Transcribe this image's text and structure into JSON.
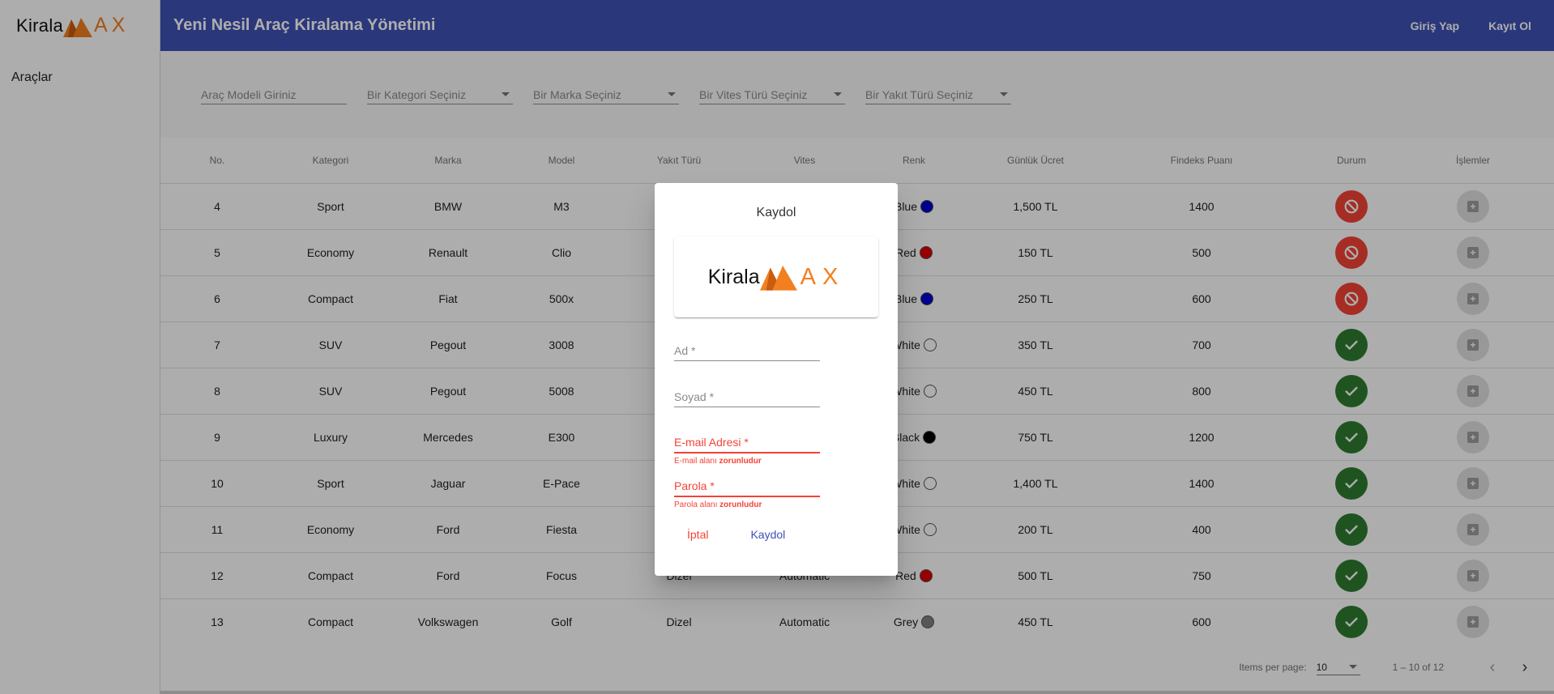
{
  "brand": {
    "name": "Kirala",
    "ax": "AX"
  },
  "sidebar": {
    "items": [
      {
        "label": "Araçlar"
      }
    ]
  },
  "toolbar": {
    "title": "Yeni Nesil Araç Kiralama Yönetimi",
    "login": "Giriş Yap",
    "register": "Kayıt Ol"
  },
  "filters": {
    "model_placeholder": "Araç Modeli Giriniz",
    "category_placeholder": "Bir Kategori Seçiniz",
    "brand_placeholder": "Bir Marka Seçiniz",
    "gear_placeholder": "Bir Vites Türü Seçiniz",
    "fuel_placeholder": "Bir Yakıt Türü Seçiniz"
  },
  "table": {
    "headers": [
      "No.",
      "Kategori",
      "Marka",
      "Model",
      "Yakıt Türü",
      "Vites",
      "Renk",
      "Günlük Ücret",
      "Findeks Puanı",
      "Durum",
      "İşlemler"
    ],
    "rows": [
      {
        "no": "4",
        "category": "Sport",
        "brand": "BMW",
        "model": "M3",
        "fuel": "",
        "gear": "",
        "color": "Blue",
        "color_hex": "#0000d0",
        "price": "1,500 TL",
        "findeks": "1400",
        "status": "unavailable"
      },
      {
        "no": "5",
        "category": "Economy",
        "brand": "Renault",
        "model": "Clio",
        "fuel": "",
        "gear": "",
        "color": "Red",
        "color_hex": "#e00000",
        "price": "150 TL",
        "findeks": "500",
        "status": "unavailable"
      },
      {
        "no": "6",
        "category": "Compact",
        "brand": "Fiat",
        "model": "500x",
        "fuel": "",
        "gear": "",
        "color": "Blue",
        "color_hex": "#0000d0",
        "price": "250 TL",
        "findeks": "600",
        "status": "unavailable"
      },
      {
        "no": "7",
        "category": "SUV",
        "brand": "Pegout",
        "model": "3008",
        "fuel": "",
        "gear": "",
        "color": "White",
        "color_hex": "#ffffff",
        "price": "350 TL",
        "findeks": "700",
        "status": "available"
      },
      {
        "no": "8",
        "category": "SUV",
        "brand": "Pegout",
        "model": "5008",
        "fuel": "",
        "gear": "",
        "color": "White",
        "color_hex": "#ffffff",
        "price": "450 TL",
        "findeks": "800",
        "status": "available"
      },
      {
        "no": "9",
        "category": "Luxury",
        "brand": "Mercedes",
        "model": "E300",
        "fuel": "",
        "gear": "",
        "color": "Black",
        "color_hex": "#000000",
        "price": "750 TL",
        "findeks": "1200",
        "status": "available"
      },
      {
        "no": "10",
        "category": "Sport",
        "brand": "Jaguar",
        "model": "E-Pace",
        "fuel": "",
        "gear": "",
        "color": "White",
        "color_hex": "#ffffff",
        "price": "1,400 TL",
        "findeks": "1400",
        "status": "available"
      },
      {
        "no": "11",
        "category": "Economy",
        "brand": "Ford",
        "model": "Fiesta",
        "fuel": "",
        "gear": "",
        "color": "White",
        "color_hex": "#ffffff",
        "price": "200 TL",
        "findeks": "400",
        "status": "available"
      },
      {
        "no": "12",
        "category": "Compact",
        "brand": "Ford",
        "model": "Focus",
        "fuel": "Dizel",
        "gear": "Automatic",
        "color": "Red",
        "color_hex": "#e00000",
        "price": "500 TL",
        "findeks": "750",
        "status": "available"
      },
      {
        "no": "13",
        "category": "Compact",
        "brand": "Volkswagen",
        "model": "Golf",
        "fuel": "Dizel",
        "gear": "Automatic",
        "color": "Grey",
        "color_hex": "#808080",
        "price": "450 TL",
        "findeks": "600",
        "status": "available"
      }
    ]
  },
  "paginator": {
    "items_per_page_label": "Items per page:",
    "items_per_page_value": "10",
    "range_label": "1 – 10 of 12"
  },
  "dialog": {
    "title": "Kaydol",
    "first_name_label": "Ad *",
    "last_name_label": "Soyad *",
    "email_label": "E-mail Adresi *",
    "email_error_prefix": "E-mail alanı ",
    "email_error_bold": "zorunludur",
    "password_label": "Parola *",
    "password_error_prefix": "Parola alanı ",
    "password_error_bold": "zorunludur",
    "cancel_label": "İptal",
    "submit_label": "Kaydol"
  },
  "colors": {
    "primary": "#3f51b5",
    "accent": "#f28020",
    "warn": "#f44336",
    "success": "#2e7d32"
  }
}
